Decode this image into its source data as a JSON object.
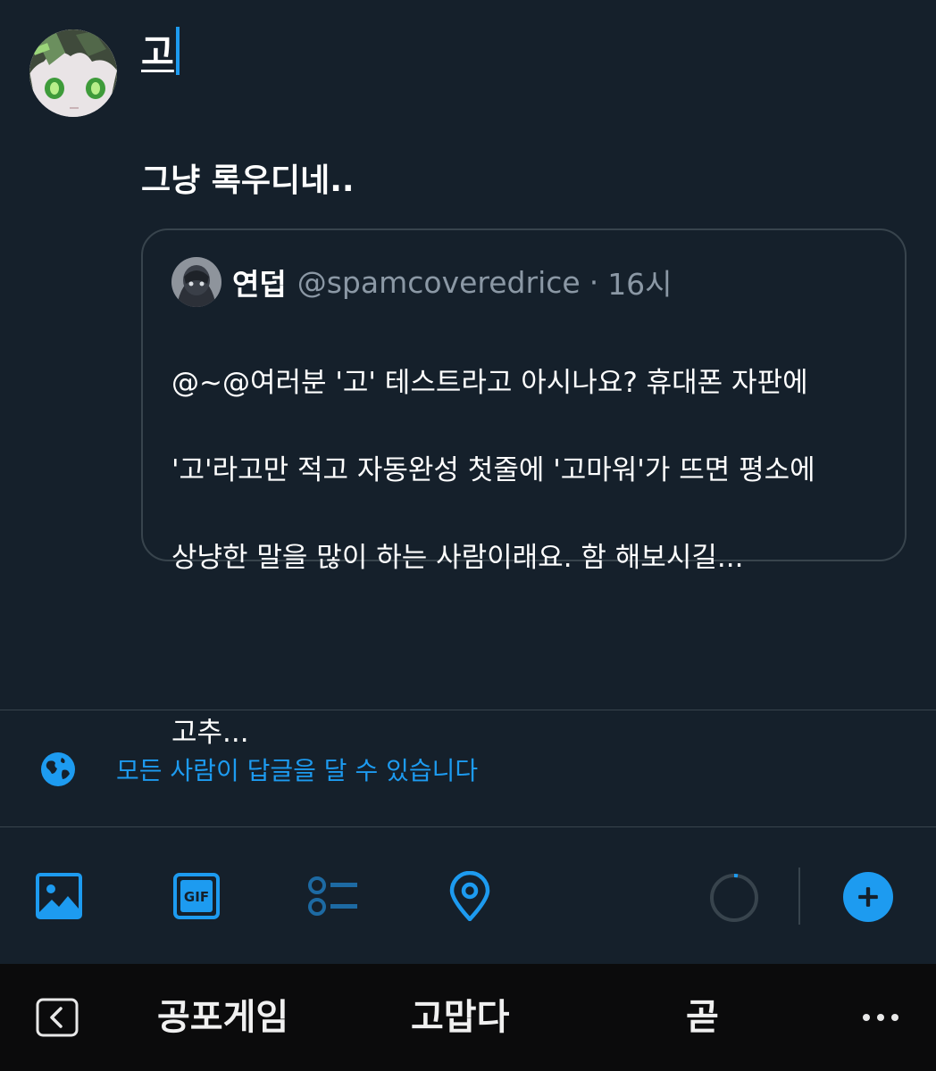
{
  "composer": {
    "typed_text": "고",
    "comment": "그냥 록우디네.."
  },
  "quote": {
    "name": "연덥",
    "handle": "@spamcoveredrice",
    "separator": "·",
    "time": "16시",
    "body_line1": "@~@여러분 '고' 테스트라고 아시나요? 휴대폰 자판에",
    "body_line2": "'고'라고만 적고 자동완성 첫줄에 '고마워'가 뜨면 평소에",
    "body_line3": "상냥한 말을 많이 하는 사람이래요. 함 해보시길...",
    "body_line4": "고추..."
  },
  "reply_setting": {
    "label": "모든 사람이 답글을 달 수 있습니다"
  },
  "toolbar": {
    "icons": [
      "image-icon",
      "gif-icon",
      "poll-icon",
      "location-icon"
    ],
    "gif_text": "GIF"
  },
  "keyboard": {
    "suggestions": [
      "공포게임",
      "고맙다",
      "곧"
    ]
  },
  "colors": {
    "background": "#15202b",
    "accent": "#1d9bf0",
    "muted": "#8b98a5",
    "border": "#38444d"
  }
}
